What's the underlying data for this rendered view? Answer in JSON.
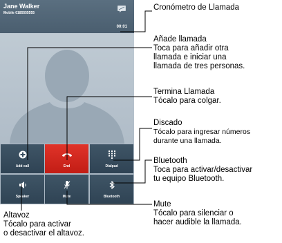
{
  "screen": {
    "caller_name": "Jane Walker",
    "caller_number": "Mobile 0185555555",
    "call_timer": "00:01",
    "buttons": [
      {
        "label": "Add call",
        "icon": "plus-circle-icon"
      },
      {
        "label": "End",
        "icon": "phone-hangup-icon"
      },
      {
        "label": "Dialpad",
        "icon": "dialpad-icon"
      },
      {
        "label": "Speaker",
        "icon": "speaker-icon"
      },
      {
        "label": "Mute",
        "icon": "mic-mute-icon"
      },
      {
        "label": "Bluetooth",
        "icon": "bluetooth-icon"
      }
    ],
    "colors": {
      "end_button": "#d9281f",
      "button_bg": "#384d5e",
      "header_bg": "#516678"
    }
  },
  "callouts": {
    "timer": {
      "title": "Cronómetro de Llamada"
    },
    "add_call": {
      "title": "Añade llamada",
      "line1": "Toca para añadir otra",
      "line2": "llamada e iniciar una",
      "line3": "llamada de tres personas."
    },
    "end_call": {
      "title": "Termina Llamada",
      "line1": "Tócalo para colgar."
    },
    "dialpad": {
      "title": "Discado",
      "line1": "Tócalo para ingresar números",
      "line2": "durante una llamada."
    },
    "bluetooth": {
      "title": "Bluetooth",
      "line1": "Toca para activar/desactivar",
      "line2": "tu equipo Bluetooth."
    },
    "speaker": {
      "title": "Altavoz",
      "line1": "Tócalo para activar",
      "line2": "o desactivar el altavoz."
    },
    "mute": {
      "title": "Mute",
      "line1": "Tócalo para silenciar o",
      "line2": "hacer audible la llamada."
    }
  }
}
